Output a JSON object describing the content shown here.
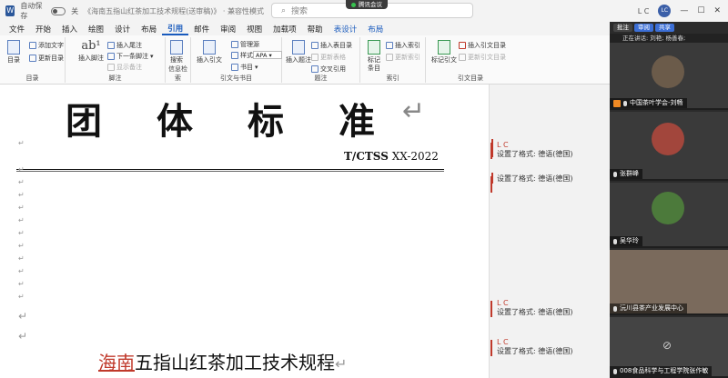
{
  "titlebar": {
    "autosave_label": "自动保存",
    "autosave_state": "关",
    "doc_title": "《海南五指山红茶加工技术规程(送审稿)》 · 兼容性模式",
    "search_placeholder": "搜索",
    "meeting_badge": "腾讯会议",
    "user_initials_text": "L C",
    "user_avatar": "LC"
  },
  "menu": [
    "文件",
    "开始",
    "插入",
    "绘图",
    "设计",
    "布局",
    "引用",
    "邮件",
    "审阅",
    "视图",
    "加载项",
    "帮助",
    "表设计",
    "布局"
  ],
  "menu_active_index": 6,
  "ribbon": {
    "toc": {
      "big": "目录",
      "add_text": "添加文字",
      "update": "更新目录",
      "label": "目录"
    },
    "footnote": {
      "insert_footnote": "插入脚注",
      "insert_endnote": "插入尾注",
      "next_footnote": "下一条脚注",
      "show_notes": "显示备注",
      "label": "脚注"
    },
    "research": {
      "search": "搜索",
      "label": "信息检索"
    },
    "citation": {
      "insert_citation": "插入引文",
      "manage_sources": "管理源",
      "style_label": "样式:",
      "style_value": "APA",
      "bibliography": "书目",
      "label": "引文与书目"
    },
    "caption": {
      "insert_caption": "插入题注",
      "insert_table_of_figures": "插入表目录",
      "update_table": "更新表格",
      "cross_reference": "交叉引用",
      "label": "题注"
    },
    "index": {
      "mark_entry": "标记条目",
      "insert_index": "插入索引",
      "update_index": "更新索引",
      "label": "索引"
    },
    "toa": {
      "mark_citation": "标记引文",
      "insert_toa": "插入引文目录",
      "update_toa": "更新引文目录",
      "label": "引文目录"
    }
  },
  "document": {
    "big_title_chars": [
      "团",
      "体",
      "标",
      "准"
    ],
    "standard_prefix": "T/CTSS",
    "standard_suffix": " XX-2022",
    "paragraph_mark": "↵",
    "subtitle_inserted": "海南",
    "subtitle_rest": "五指山红茶加工技术规程"
  },
  "comments": [
    {
      "who": "L C",
      "text": "设置了格式: 德语(德国)"
    },
    {
      "who": "",
      "text": "设置了格式: 德语(德国)"
    },
    {
      "who": "L C",
      "text": "设置了格式: 德语(德国)"
    },
    {
      "who": "L C",
      "text": "设置了格式: 德语(德国)"
    }
  ],
  "meeting": {
    "buttons": [
      "批注",
      "审阅",
      "共享"
    ],
    "speaking": "正在讲话: 刘艳; 杨善春;",
    "participants": [
      {
        "name": "中国茶叶学会-刘畅"
      },
      {
        "name": "张群峰"
      },
      {
        "name": "吴华玲"
      },
      {
        "name": "沅川县茶产业发展中心"
      },
      {
        "name": "008食品科学与工程学院张作敏"
      }
    ]
  },
  "colors": {
    "accent": "#185abd",
    "revision_red": "#c0392b",
    "meeting_blue": "#3c6fd6"
  }
}
